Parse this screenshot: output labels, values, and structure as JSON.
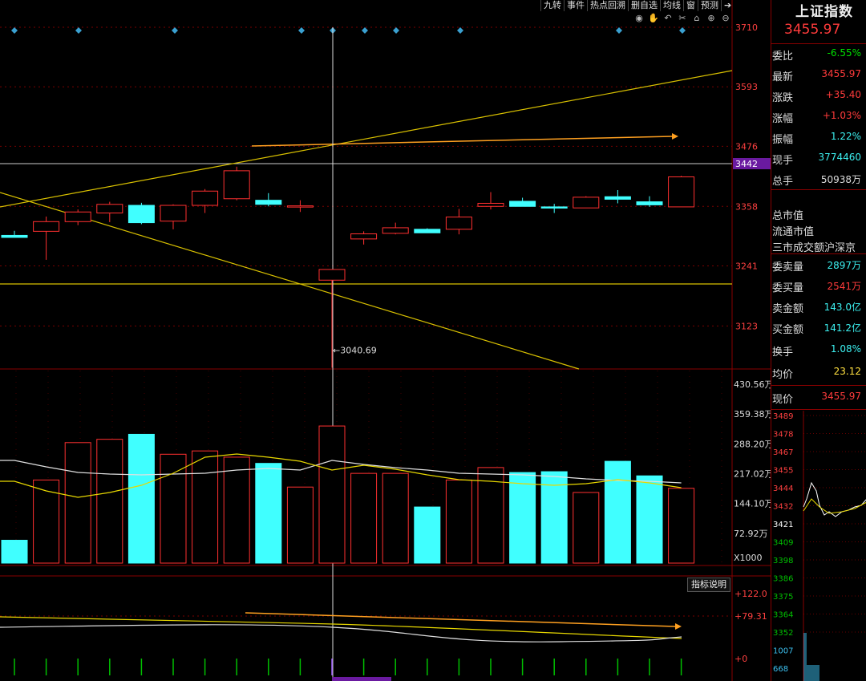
{
  "toolbar": [
    "九转",
    "事件",
    "热点回溯",
    "删自选",
    "均线",
    "窗",
    "预测"
  ],
  "tool_icons": [
    "eye-icon",
    "hand-icon",
    "undo-icon",
    "scissors-icon",
    "lock-icon",
    "zoom-in-icon",
    "zoom-out-icon"
  ],
  "panel": {
    "title": "上证指数",
    "price": "3455.97",
    "rows": [
      {
        "label": "委比",
        "value": "-6.55%",
        "color": "green"
      },
      {
        "label": "最新",
        "value": "3455.97",
        "color": "red"
      },
      {
        "label": "涨跌",
        "value": "+35.40",
        "color": "red"
      },
      {
        "label": "涨幅",
        "value": "+1.03%",
        "color": "red"
      },
      {
        "label": "振幅",
        "value": "1.22%",
        "color": "cyan"
      },
      {
        "label": "现手",
        "value": "3774460",
        "color": "cyan"
      },
      {
        "label": "总手",
        "value": "50938万",
        "color": "white"
      },
      {
        "label": "总市值",
        "value": "",
        "color": "white"
      },
      {
        "label": "流通市值",
        "value": "",
        "color": "white"
      },
      {
        "label": "三市成交额沪深京",
        "value": "",
        "color": "white"
      },
      {
        "label": "委卖量",
        "value": "2897万",
        "color": "cyan"
      },
      {
        "label": "委买量",
        "value": "2541万",
        "color": "red"
      },
      {
        "label": "卖金额",
        "value": "143.0亿",
        "color": "cyan"
      },
      {
        "label": "买金额",
        "value": "141.2亿",
        "color": "cyan"
      },
      {
        "label": "换手",
        "value": "1.08%",
        "color": "cyan"
      },
      {
        "label": "均价",
        "value": "23.12",
        "color": "yellow"
      }
    ],
    "now_label": "现价",
    "now_value": "3455.97",
    "mini_ticks": [
      "3489",
      "3478",
      "3467",
      "3455",
      "3444",
      "3432",
      "3421",
      "3409",
      "3398",
      "3386",
      "3375",
      "3364",
      "3352",
      "1007",
      "668"
    ]
  },
  "indicator_button": "指标说明",
  "chart_data": {
    "type": "candlestick",
    "price_axis_ticks": [
      "3710",
      "3593",
      "3476",
      "3358",
      "3241",
      "3123"
    ],
    "price_range": [
      3000,
      3730
    ],
    "current_price_tag": "3442",
    "low_marker": "3040.69",
    "candles": [
      {
        "o": 3301,
        "c": 3297,
        "h": 3310,
        "l": 3297
      },
      {
        "o": 3309,
        "c": 3328,
        "h": 3338,
        "l": 3253
      },
      {
        "o": 3328,
        "c": 3347,
        "h": 3352,
        "l": 3321
      },
      {
        "o": 3345,
        "c": 3362,
        "h": 3367,
        "l": 3327
      },
      {
        "o": 3360,
        "c": 3326,
        "h": 3365,
        "l": 3323
      },
      {
        "o": 3329,
        "c": 3360,
        "h": 3362,
        "l": 3313
      },
      {
        "o": 3360,
        "c": 3388,
        "h": 3392,
        "l": 3345
      },
      {
        "o": 3373,
        "c": 3428,
        "h": 3436,
        "l": 3370
      },
      {
        "o": 3370,
        "c": 3362,
        "h": 3384,
        "l": 3358
      },
      {
        "o": 3359,
        "c": 3359,
        "h": 3370,
        "l": 3347
      },
      {
        "o": 3213,
        "c": 3234,
        "h": 3234,
        "l": 3040.69
      },
      {
        "o": 3294,
        "c": 3304,
        "h": 3309,
        "l": 3283
      },
      {
        "o": 3305,
        "c": 3316,
        "h": 3326,
        "l": 3303
      },
      {
        "o": 3313,
        "c": 3306,
        "h": 3315,
        "l": 3306
      },
      {
        "o": 3313,
        "c": 3337,
        "h": 3353,
        "l": 3303
      },
      {
        "o": 3358,
        "c": 3364,
        "h": 3386,
        "l": 3352
      },
      {
        "o": 3368,
        "c": 3358,
        "h": 3375,
        "l": 3358
      },
      {
        "o": 3357,
        "c": 3356,
        "h": 3363,
        "l": 3345
      },
      {
        "o": 3355,
        "c": 3376,
        "h": 3378,
        "l": 3355
      },
      {
        "o": 3377,
        "c": 3372,
        "h": 3390,
        "l": 3364
      },
      {
        "o": 3367,
        "c": 3361,
        "h": 3378,
        "l": 3357
      },
      {
        "o": 3357,
        "c": 3416,
        "h": 3418,
        "l": 3357
      }
    ],
    "volume_axis_ticks": [
      "430.56万",
      "359.38万",
      "288.20万",
      "217.02万",
      "144.10万",
      "72.92万",
      "X1000"
    ],
    "volume_max": 430.56,
    "volumes": [
      55,
      200,
      290,
      298,
      310,
      262,
      270,
      255,
      240,
      183,
      330,
      216,
      216,
      135,
      200,
      230,
      218,
      220,
      170,
      245,
      210,
      180
    ],
    "indicator_axis_ticks": [
      "+122.0",
      "+79.31",
      "+0"
    ]
  }
}
